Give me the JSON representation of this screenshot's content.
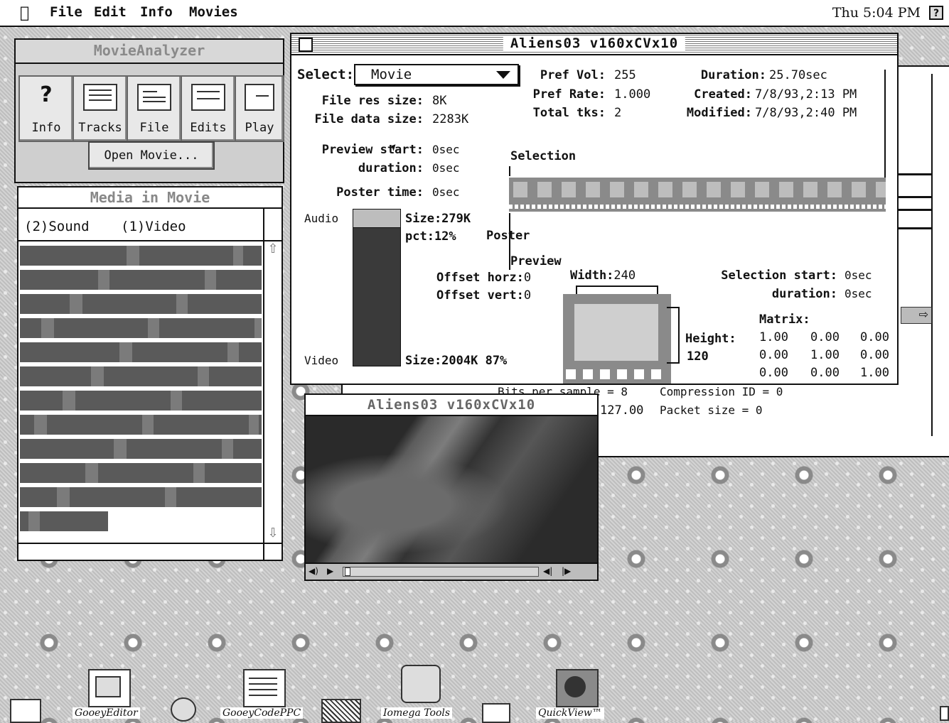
{
  "menubar": {
    "items": [
      "File",
      "Edit",
      "Info",
      "Movies"
    ],
    "clock": "Thu 5:04 PM"
  },
  "analyzer": {
    "title": "MovieAnalyzer",
    "tools": [
      {
        "label": "Info",
        "glyph": "?"
      },
      {
        "label": "Tracks"
      },
      {
        "label": "File"
      },
      {
        "label": "Edits"
      },
      {
        "label": "Play"
      }
    ],
    "open_button": "Open Movie...",
    "media_title": "Media in Movie",
    "media_header_1": "(2)Sound",
    "media_header_2": "(1)Video",
    "scroll_up": "⇧",
    "scroll_down": "⇩"
  },
  "info": {
    "title": "Aliens03 v160xCVx10",
    "select_label": "Select:",
    "select_value": "Movie",
    "file_res_label": "File res size:",
    "file_res_value": "8K",
    "file_data_label": "File data size:",
    "file_data_value": "2283K",
    "pref_vol_label": "Pref Vol:",
    "pref_vol_value": "255",
    "pref_rate_label": "Pref Rate:",
    "pref_rate_value": "1.000",
    "total_tks_label": "Total tks:",
    "total_tks_value": "2",
    "duration_label": "Duration:",
    "duration_value": "25.70sec",
    "created_label": "Created:",
    "created_value": "7/8/93,2:13 PM",
    "modified_label": "Modified:",
    "modified_value": "7/8/93,2:40 PM",
    "preview_start_label": "Preview start:",
    "preview_start_value": "0sec",
    "preview_dur_label": "duration:",
    "preview_dur_value": "0sec",
    "poster_time_label": "Poster time:",
    "poster_time_value": "0sec",
    "selection_label": "Selection",
    "poster_label": "Poster",
    "preview_label": "Preview",
    "audio_label": "Audio",
    "video_label": "Video",
    "audio_size": "Size:279K",
    "audio_pct": "pct:12%",
    "video_size": "Size:2004K 87%",
    "audio_fraction": 0.12,
    "offset_horz_label": "Offset horz:",
    "offset_horz_value": "0",
    "offset_vert_label": "Offset vert:",
    "offset_vert_value": "0",
    "width_label": "Width:",
    "width_value": "240",
    "height_label": "Height:",
    "height_value": "120",
    "sel_start_label": "Selection start:",
    "sel_start_value": "0sec",
    "sel_dur_label": "duration:",
    "sel_dur_value": "0sec",
    "matrix_label": "Matrix:",
    "matrix": [
      [
        "1.00",
        "0.00",
        "0.00"
      ],
      [
        "0.00",
        "1.00",
        "0.00"
      ],
      [
        "0.00",
        "0.00",
        "1.00"
      ]
    ]
  },
  "back_window": {
    "line1_left": "Bits per sample = 8",
    "line1_right": "Compression ID = 0",
    "line2_left": "127.00",
    "line2_right": "Packet size = 0"
  },
  "movie": {
    "title": "Aliens03 v160xCVx10"
  },
  "desktop_icons": [
    {
      "label": "GooeyEditor"
    },
    {
      "label": "GooeyCodePPC"
    },
    {
      "label": "Iomega Tools"
    },
    {
      "label": "QuickView™"
    }
  ]
}
